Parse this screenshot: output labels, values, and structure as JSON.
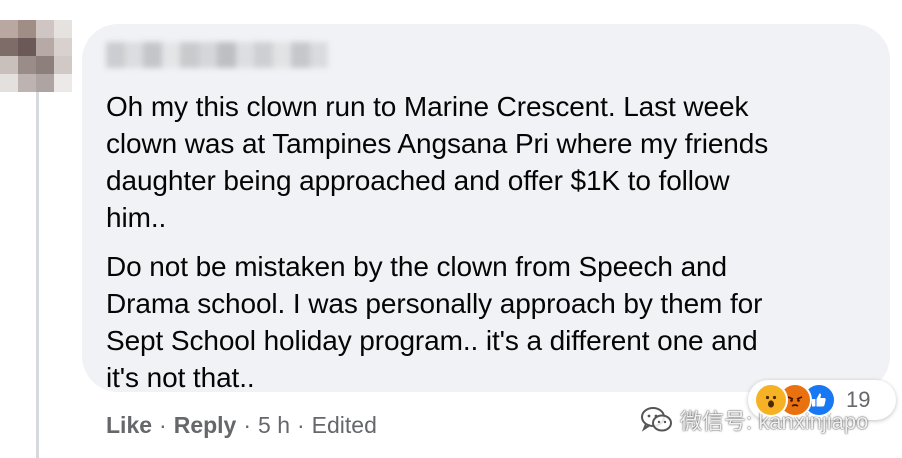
{
  "comment": {
    "author_name": "",
    "paragraphs": [
      "Oh my this clown run to Marine Crescent. Last week\nclown was at Tampines Angsana Pri where my friends\ndaughter being approached and offer $1K to follow\nhim..",
      "Do not be mistaken by the clown from Speech and\nDrama school. I was personally approach by them for\nSept School holiday program.. it's a different one and\nit's not that.."
    ]
  },
  "actions": {
    "like_label": "Like",
    "reply_label": "Reply",
    "time": "5 h",
    "edited_label": "Edited",
    "separator": "·"
  },
  "reactions": {
    "icons": [
      "wow-reaction-icon",
      "angry-reaction-icon",
      "like-reaction-icon"
    ],
    "count": "19"
  },
  "watermark": {
    "text": "微信号: kanxinjiapo"
  },
  "colors": {
    "bubble": "#f0f2f5",
    "text": "#050505",
    "meta": "#65676b",
    "like_blue": "#1877f2"
  }
}
